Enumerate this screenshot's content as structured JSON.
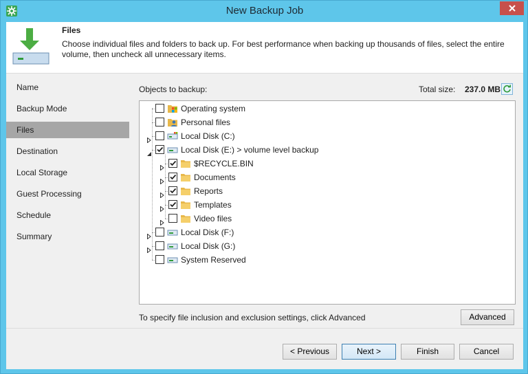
{
  "window": {
    "title": "New Backup Job",
    "accent_color": "#5ec6ea",
    "close_color": "#c7504b"
  },
  "header": {
    "title": "Files",
    "description": "Choose individual files and folders to back up. For best performance when backing up thousands of files, select the entire volume, then uncheck all unnecessary items."
  },
  "nav": {
    "items": [
      {
        "label": "Name"
      },
      {
        "label": "Backup Mode"
      },
      {
        "label": "Files",
        "active": true
      },
      {
        "label": "Destination"
      },
      {
        "label": "Local Storage"
      },
      {
        "label": "Guest Processing"
      },
      {
        "label": "Schedule"
      },
      {
        "label": "Summary"
      }
    ]
  },
  "objects": {
    "label": "Objects to backup:",
    "total_size_label": "Total size:",
    "total_size_value": "237.0 MB",
    "tree": [
      {
        "label": "Operating system",
        "icon": "windows-os-icon",
        "checked": false,
        "level": 0,
        "expander": "none"
      },
      {
        "label": "Personal files",
        "icon": "user-folder-icon",
        "checked": false,
        "level": 0,
        "expander": "none"
      },
      {
        "label": "Local Disk (C:)",
        "icon": "system-drive-icon",
        "checked": false,
        "level": 0,
        "expander": "collapsed"
      },
      {
        "label": "Local Disk (E:) > volume level backup",
        "icon": "drive-icon",
        "checked": true,
        "level": 0,
        "expander": "expanded"
      },
      {
        "label": "$RECYCLE.BIN",
        "icon": "folder-icon",
        "checked": true,
        "level": 1,
        "expander": "collapsed"
      },
      {
        "label": "Documents",
        "icon": "folder-icon",
        "checked": true,
        "level": 1,
        "expander": "collapsed"
      },
      {
        "label": "Reports",
        "icon": "folder-icon",
        "checked": true,
        "level": 1,
        "expander": "collapsed"
      },
      {
        "label": "Templates",
        "icon": "folder-icon",
        "checked": true,
        "level": 1,
        "expander": "collapsed"
      },
      {
        "label": "Video files",
        "icon": "folder-icon",
        "checked": false,
        "level": 1,
        "expander": "collapsed"
      },
      {
        "label": "Local Disk (F:)",
        "icon": "drive-icon",
        "checked": false,
        "level": 0,
        "expander": "collapsed"
      },
      {
        "label": "Local Disk (G:)",
        "icon": "drive-icon",
        "checked": false,
        "level": 0,
        "expander": "collapsed"
      },
      {
        "label": "System Reserved",
        "icon": "drive-icon",
        "checked": false,
        "level": 0,
        "expander": "none"
      }
    ]
  },
  "hint": "To specify file inclusion and exclusion settings, click Advanced",
  "buttons": {
    "advanced": "Advanced",
    "previous": "< Previous",
    "next": "Next >",
    "finish": "Finish",
    "cancel": "Cancel"
  }
}
